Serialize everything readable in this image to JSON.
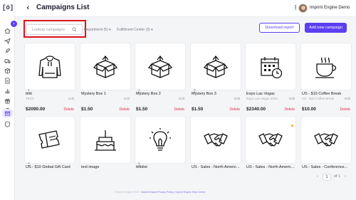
{
  "app": {
    "logo": "[ó]",
    "title": "Campaigns List",
    "user_name": "Imprint Engine Demo"
  },
  "toolbar": {
    "search_placeholder": "Lookup campaigns",
    "filter_department": "Department (5)",
    "filter_fulfillment": "Fulfillment Center (3)",
    "download_label": "Download report",
    "add_label": "Add new campaign"
  },
  "sidebar": {
    "items": [
      "home-icon",
      "send-icon",
      "rocket-icon",
      "truck-icon",
      "box-icon",
      "document-icon",
      "chart-icon",
      "gift-icon",
      "globe-icon",
      "campaigns-icon",
      "shield-icon"
    ]
  },
  "campaigns": [
    {
      "name": "test",
      "sub": "TEST",
      "price": "$2090.00",
      "icon": "hoodie-icon",
      "edit": "Edit",
      "delete": "Delete"
    },
    {
      "name": "Mystery Box 1",
      "sub": "",
      "price": "$1.50",
      "icon": "open-box-icon",
      "edit": "Edit",
      "delete": "Delete"
    },
    {
      "name": "Mystery Box 2",
      "sub": "",
      "price": "$1.50",
      "icon": "open-box-icon",
      "edit": "Edit",
      "delete": "Delete"
    },
    {
      "name": "Mystery Box 3",
      "sub": "",
      "price": "$1.50",
      "icon": "open-box-icon",
      "edit": "Edit",
      "delete": "Delete"
    },
    {
      "name": "Expo Las Vegas",
      "sub": "Expo Las Vegas 2020",
      "price": "$2340.00",
      "icon": "calendar-icon",
      "edit": "Edit",
      "delete": "Delete"
    },
    {
      "name": "US - $10 Coffee Break",
      "sub": "US - $10 Coffee Break",
      "price": "$10.00",
      "icon": "coffee-cup-icon",
      "edit": "Edit",
      "delete": "Delete"
    },
    {
      "name": "US - $10 Global Gift Card",
      "icon": "ticket-icon"
    },
    {
      "name": "test image",
      "icon": "cake-icon"
    },
    {
      "name": "tekdist",
      "icon": "lightbulb-icon"
    },
    {
      "name": "US - Sales - North Americ...",
      "icon": "handshake-icon"
    },
    {
      "name": "US - Sales - North Americ...",
      "icon": "handshake-icon"
    },
    {
      "name": "US - Sales - Conference...",
      "icon": "handshake-icon"
    }
  ],
  "pagination": {
    "current": "1",
    "total_label": "of 1"
  },
  "footer": {
    "copyright": "© Imprint Engine 2023 ·",
    "links": "Imprint Engine Privacy Policy | Imprint Engine Help Center"
  },
  "colors": {
    "accent": "#5b3ff0",
    "highlight": "#e0121b",
    "delete": "#e0304a"
  }
}
